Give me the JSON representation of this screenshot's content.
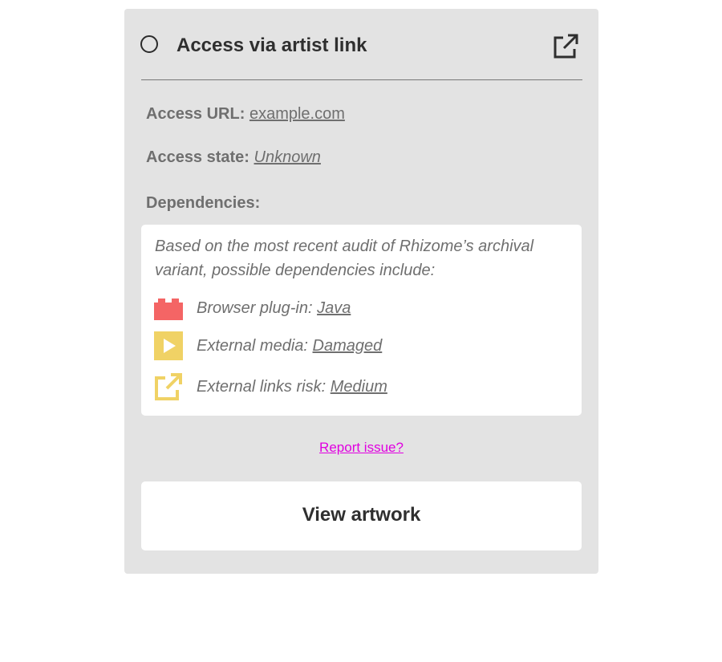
{
  "header": {
    "title": "Access via artist link"
  },
  "access_url": {
    "label": "Access URL:",
    "value": "example.com"
  },
  "access_state": {
    "label": "Access state:",
    "value": "Unknown"
  },
  "dependencies": {
    "label": "Dependencies:",
    "intro": "Based on the most recent audit of Rhizome’s archival variant, possible dependencies include:",
    "items": [
      {
        "icon": "plugin-brick-icon",
        "label": "Browser plug-in:",
        "value": "Java",
        "color": "#f46565"
      },
      {
        "icon": "play-media-icon",
        "label": "External media:",
        "value": "Damaged",
        "color": "#f0d265"
      },
      {
        "icon": "external-link-icon",
        "label": "External links risk:",
        "value": "Medium",
        "color": "#f0d265"
      }
    ]
  },
  "report": {
    "label": "Report issue?",
    "color": "#e000e0"
  },
  "view_button": {
    "label": "View artwork"
  },
  "colors": {
    "card_bg": "#e3e3e3",
    "text_muted": "#6f6f6f",
    "text_dark": "#2f2f2f"
  }
}
